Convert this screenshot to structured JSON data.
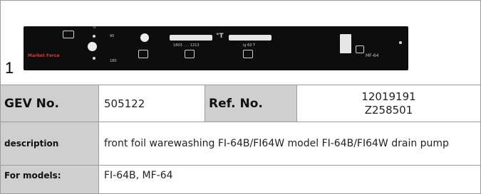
{
  "figure": {
    "number": "1",
    "panel": {
      "brand": "Market Force",
      "model_mark": "MF-64",
      "label_top": "0",
      "label_90": "90",
      "label_180": "180",
      "label_bar1": "1803 . . . 1213",
      "label_bar2": "ig 60 T",
      "temp_symbol": "°T"
    }
  },
  "table": {
    "row1": {
      "gev_label": "GEV No.",
      "gev_value": "505122",
      "ref_label": "Ref. No.",
      "ref_value_1": "12019191",
      "ref_value_2": "Z258501"
    },
    "row2": {
      "label": "description",
      "value": "front foil  warewashing FI-64B/FI64W model FI-64B/FI64W drain pump"
    },
    "row3": {
      "label": "For models:",
      "value": "FI-64B, MF-64"
    }
  },
  "colors": {
    "header_bg": "#cfcfcf",
    "border": "#9c9c9c",
    "panel": "#0d0d0d"
  }
}
